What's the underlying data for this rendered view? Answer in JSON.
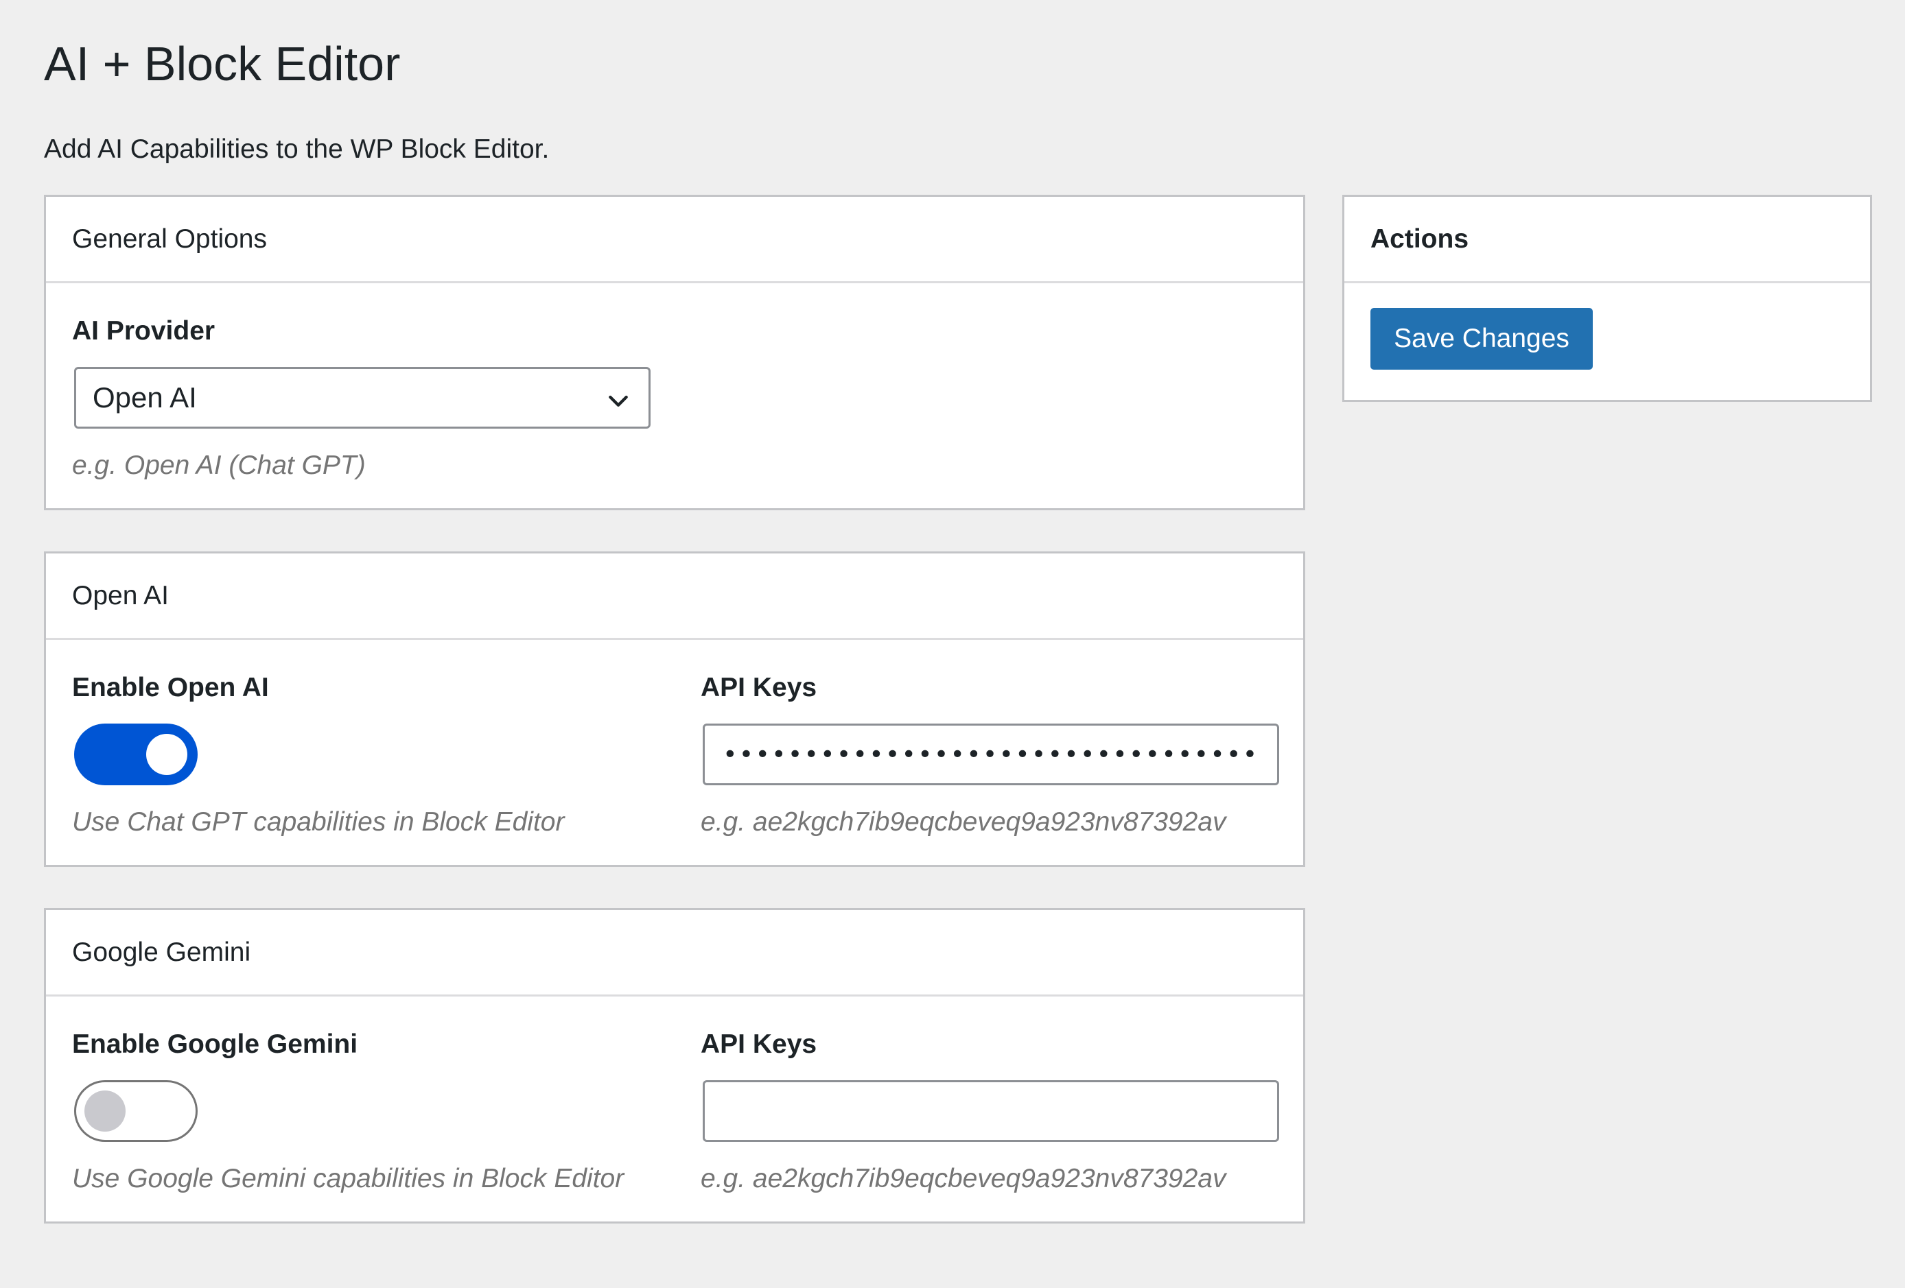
{
  "page": {
    "title": "AI + Block Editor",
    "subtitle": "Add AI Capabilities to the WP Block Editor."
  },
  "general": {
    "header": "General Options",
    "provider_label": "AI Provider",
    "provider_selected": "Open AI",
    "provider_help": "e.g. Open AI (Chat GPT)"
  },
  "openai": {
    "header": "Open AI",
    "enable_label": "Enable Open AI",
    "enabled": true,
    "enable_help": "Use Chat GPT capabilities in Block Editor",
    "api_label": "API Keys",
    "api_value": "••••••••••••••••••••••••••••••••••••••••",
    "api_help": "e.g. ae2kgch7ib9eqcbeveq9a923nv87392av"
  },
  "gemini": {
    "header": "Google Gemini",
    "enable_label": "Enable Google Gemini",
    "enabled": false,
    "enable_help": "Use Google Gemini capabilities in Block Editor",
    "api_label": "API Keys",
    "api_value": "",
    "api_help": "e.g. ae2kgch7ib9eqcbeveq9a923nv87392av"
  },
  "actions": {
    "header": "Actions",
    "save_label": "Save Changes"
  },
  "colors": {
    "primary_button": "#2271b1",
    "toggle_on": "#0055d4",
    "toggle_off_knob": "#c9c9ce",
    "background": "#efefef"
  },
  "icons": {
    "select_chevron": "chevron-down-icon"
  }
}
